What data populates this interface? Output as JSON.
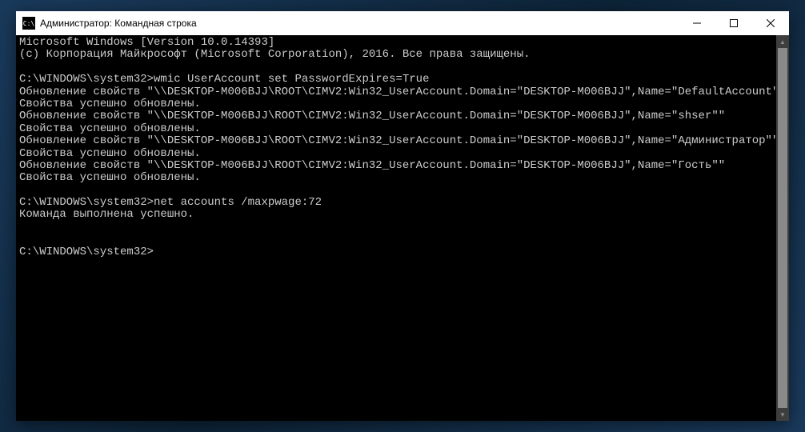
{
  "titlebar": {
    "icon_text": "C:\\",
    "title": "Администратор: Командная строка"
  },
  "console": {
    "lines": [
      "Microsoft Windows [Version 10.0.14393]",
      "(c) Корпорация Майкрософт (Microsoft Corporation), 2016. Все права защищены.",
      "",
      "C:\\WINDOWS\\system32>wmic UserAccount set PasswordExpires=True",
      "Обновление свойств \"\\\\DESKTOP-M006BJJ\\ROOT\\CIMV2:Win32_UserAccount.Domain=\"DESKTOP-M006BJJ\",Name=\"DefaultAccount\"\"",
      "Свойства успешно обновлены.",
      "Обновление свойств \"\\\\DESKTOP-M006BJJ\\ROOT\\CIMV2:Win32_UserAccount.Domain=\"DESKTOP-M006BJJ\",Name=\"shser\"\"",
      "Свойства успешно обновлены.",
      "Обновление свойств \"\\\\DESKTOP-M006BJJ\\ROOT\\CIMV2:Win32_UserAccount.Domain=\"DESKTOP-M006BJJ\",Name=\"Администратор\"\"",
      "Свойства успешно обновлены.",
      "Обновление свойств \"\\\\DESKTOP-M006BJJ\\ROOT\\CIMV2:Win32_UserAccount.Domain=\"DESKTOP-M006BJJ\",Name=\"Гость\"\"",
      "Свойства успешно обновлены.",
      "",
      "C:\\WINDOWS\\system32>net accounts /maxpwage:72",
      "Команда выполнена успешно.",
      "",
      "",
      "C:\\WINDOWS\\system32>"
    ]
  }
}
